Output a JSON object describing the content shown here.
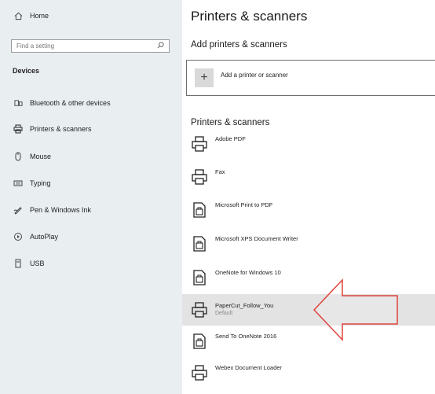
{
  "sidebar": {
    "home": "Home",
    "search_placeholder": "Find a setting",
    "section": "Devices",
    "items": [
      {
        "label": "Bluetooth & other devices",
        "icon": "bluetooth-devices-icon"
      },
      {
        "label": "Printers & scanners",
        "icon": "printer-icon"
      },
      {
        "label": "Mouse",
        "icon": "mouse-icon"
      },
      {
        "label": "Typing",
        "icon": "keyboard-icon"
      },
      {
        "label": "Pen & Windows Ink",
        "icon": "pen-icon"
      },
      {
        "label": "AutoPlay",
        "icon": "autoplay-icon"
      },
      {
        "label": "USB",
        "icon": "usb-icon"
      }
    ]
  },
  "main": {
    "title": "Printers & scanners",
    "add_section": "Add printers & scanners",
    "add_label": "Add a printer or scanner",
    "list_section": "Printers & scanners",
    "printers": [
      {
        "name": "Adobe PDF",
        "status": "",
        "icon": "printer-icon"
      },
      {
        "name": "Fax",
        "status": "",
        "icon": "printer-icon"
      },
      {
        "name": "Microsoft Print to PDF",
        "status": "",
        "icon": "document-printer-icon"
      },
      {
        "name": "Microsoft XPS Document Writer",
        "status": "",
        "icon": "document-printer-icon"
      },
      {
        "name": "OneNote for Windows 10",
        "status": "",
        "icon": "document-printer-icon"
      },
      {
        "name": "PaperCut_Follow_You",
        "status": "Default",
        "icon": "printer-icon"
      },
      {
        "name": "Send To OneNote 2016",
        "status": "",
        "icon": "document-printer-icon"
      },
      {
        "name": "Webex Document Loader",
        "status": "",
        "icon": "printer-icon"
      }
    ]
  },
  "colors": {
    "sidebar_bg": "#e9eef1",
    "selected_row": "#e3e3e3",
    "arrow_stroke": "#e0433c"
  }
}
